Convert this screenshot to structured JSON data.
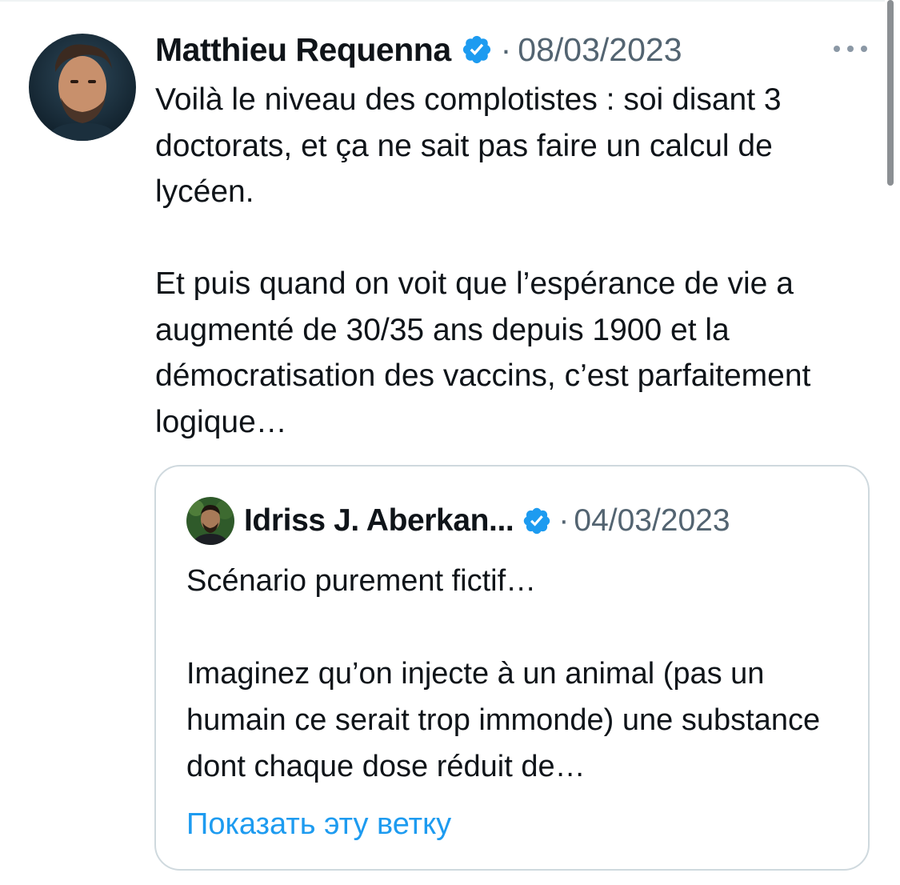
{
  "tweet": {
    "author_name": "Matthieu Requenna",
    "separator": "·",
    "date": "08/03/2023",
    "text": "Voilà le niveau des complotistes : soi disant 3 doctorats, et ça ne sait pas faire un calcul de lycéen.\n\nEt puis quand on voit que l’espérance de vie a augmenté de 30/35 ans depuis 1900 et la démocratisation des vaccins, c’est parfaitement logique…"
  },
  "quoted_tweet": {
    "author_name": "Idriss J. Aberkan...",
    "separator": "·",
    "date": "04/03/2023",
    "text": "Scénario purement fictif…\n\nImaginez qu’on injecte à un animal (pas un humain ce serait trop immonde) une substance dont chaque dose réduit de…",
    "show_thread_label": "Показать эту ветку"
  },
  "icons": {
    "verified": "verified-badge-icon",
    "more": "more-options-icon"
  },
  "colors": {
    "accent": "#1d9bf0",
    "secondary_text": "#536471",
    "border": "#cfd9de"
  }
}
